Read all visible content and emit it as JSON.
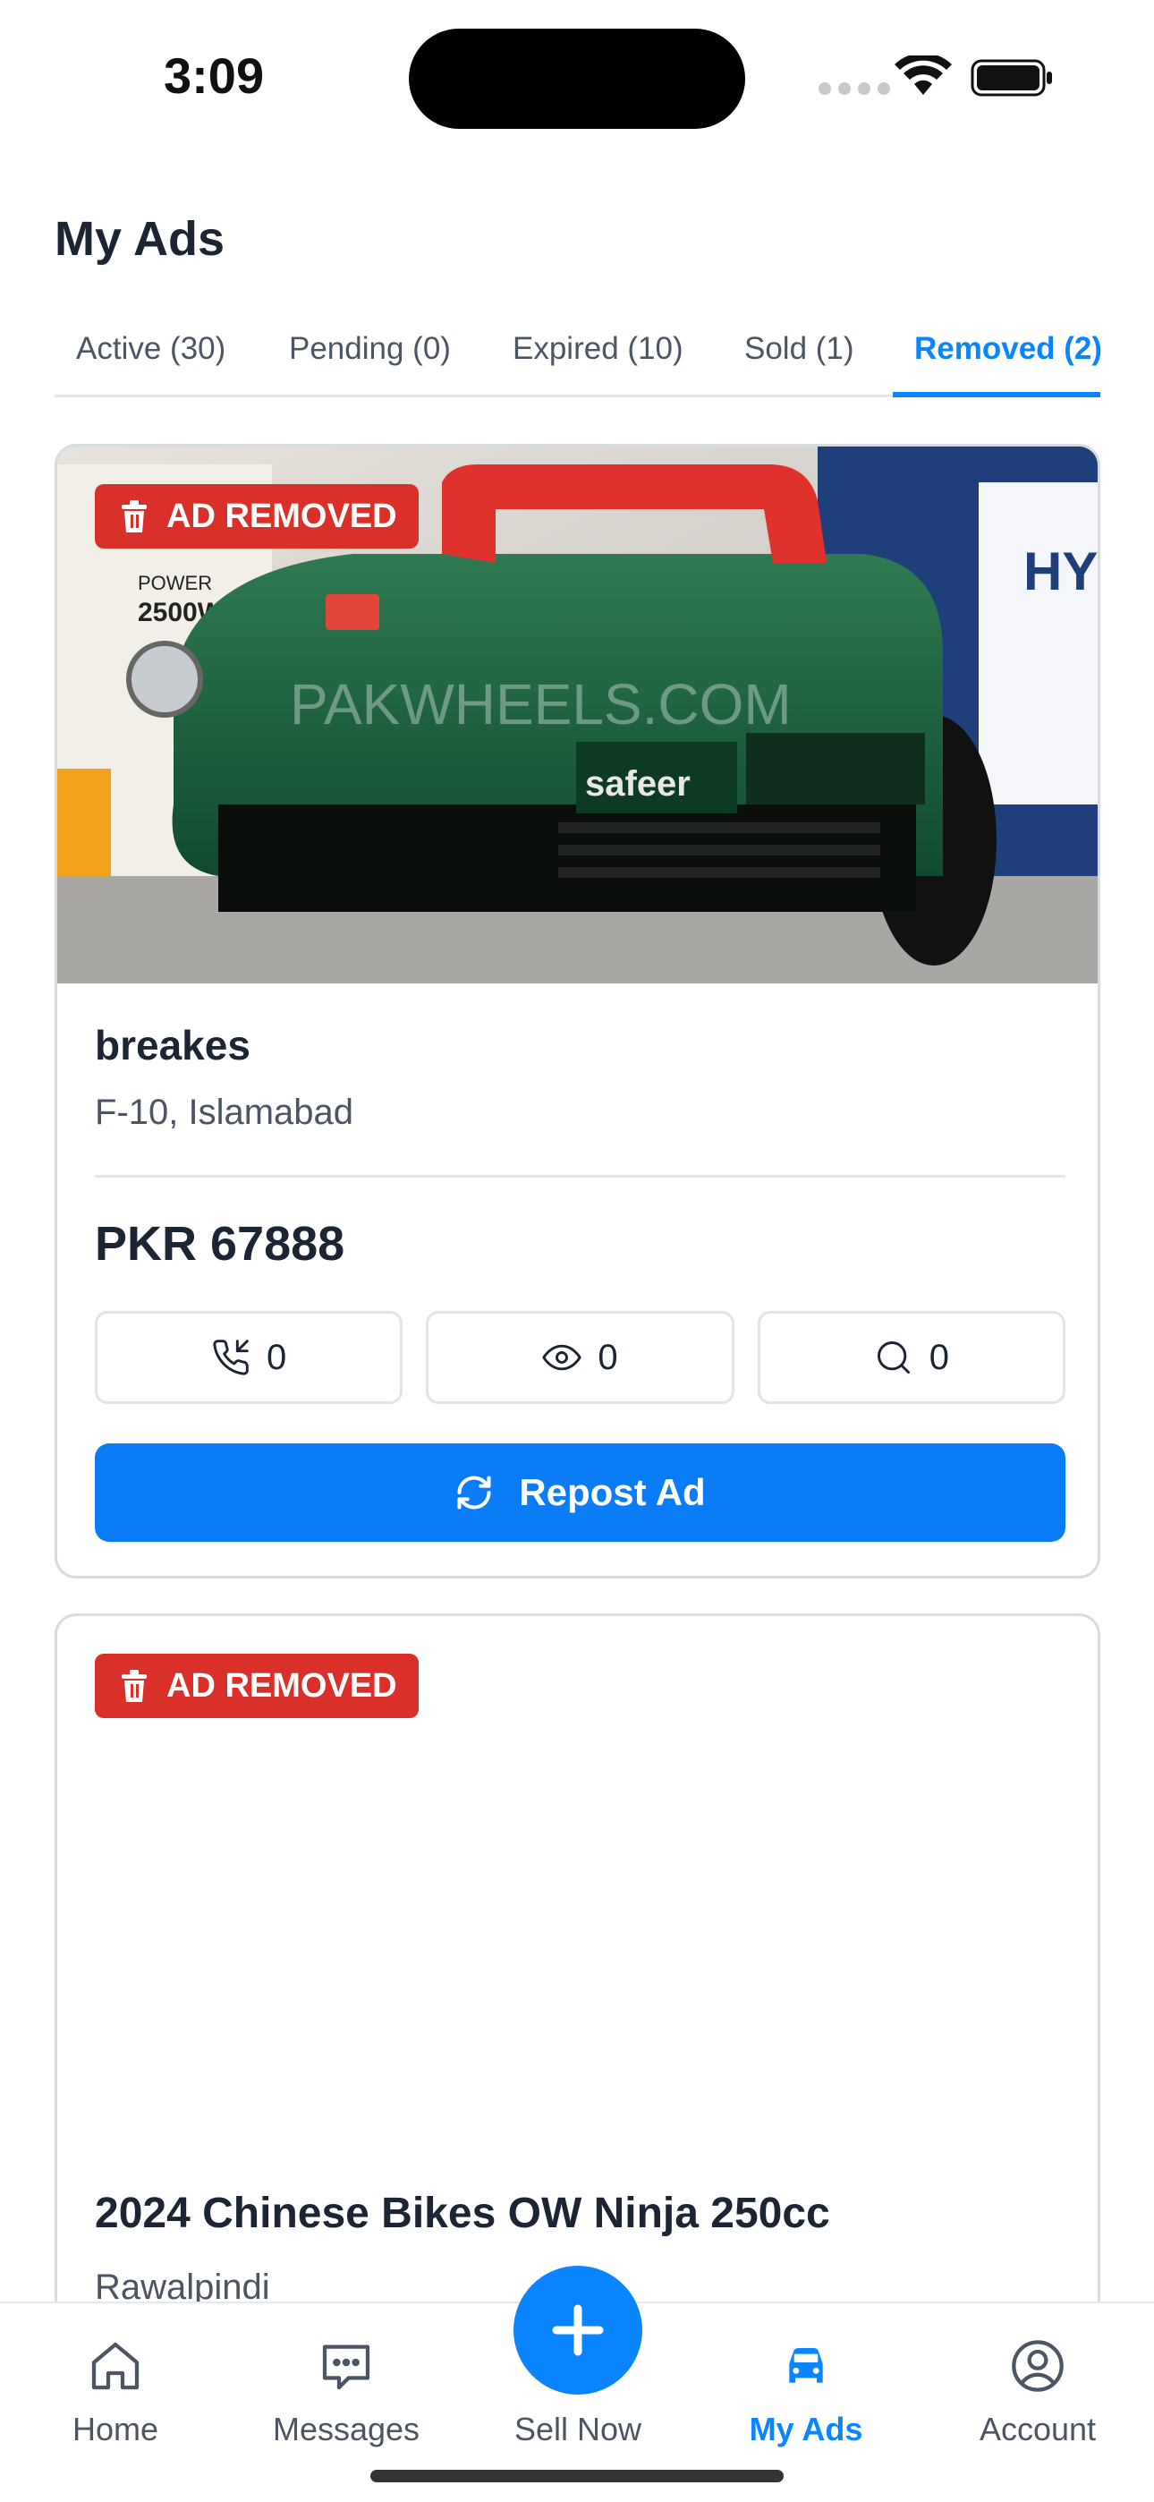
{
  "status_bar": {
    "time": "3:09"
  },
  "page": {
    "title": "My Ads"
  },
  "tabs": [
    {
      "label": "Active (30)",
      "active": false
    },
    {
      "label": "Pending (0)",
      "active": false
    },
    {
      "label": "Expired (10)",
      "active": false
    },
    {
      "label": "Sold (1)",
      "active": false
    },
    {
      "label": "Removed (2)",
      "active": true
    }
  ],
  "ads": [
    {
      "badge": "AD REMOVED",
      "image_watermark": "PAKWHEELS.COM",
      "title": "breakes",
      "location": "F-10, Islamabad",
      "price": "PKR 67888",
      "stats": {
        "calls": "0",
        "views": "0",
        "searches": "0"
      },
      "action_label": "Repost Ad"
    },
    {
      "badge": "AD REMOVED",
      "title": "2024 Chinese Bikes OW Ninja 250cc",
      "location": "Rawalpindi"
    }
  ],
  "bottom_nav": {
    "items": [
      {
        "label": "Home",
        "icon": "home-icon"
      },
      {
        "label": "Messages",
        "icon": "messages-icon"
      },
      {
        "label": "Sell Now",
        "icon": "plus-icon"
      },
      {
        "label": "My Ads",
        "icon": "car-icon",
        "active": true
      },
      {
        "label": "Account",
        "icon": "account-icon"
      }
    ]
  },
  "colors": {
    "accent": "#0a84ff",
    "badge_red": "#d9302a",
    "primary_button": "#0a7cf6",
    "text_primary": "#1c2533",
    "text_secondary": "#4b5563"
  }
}
